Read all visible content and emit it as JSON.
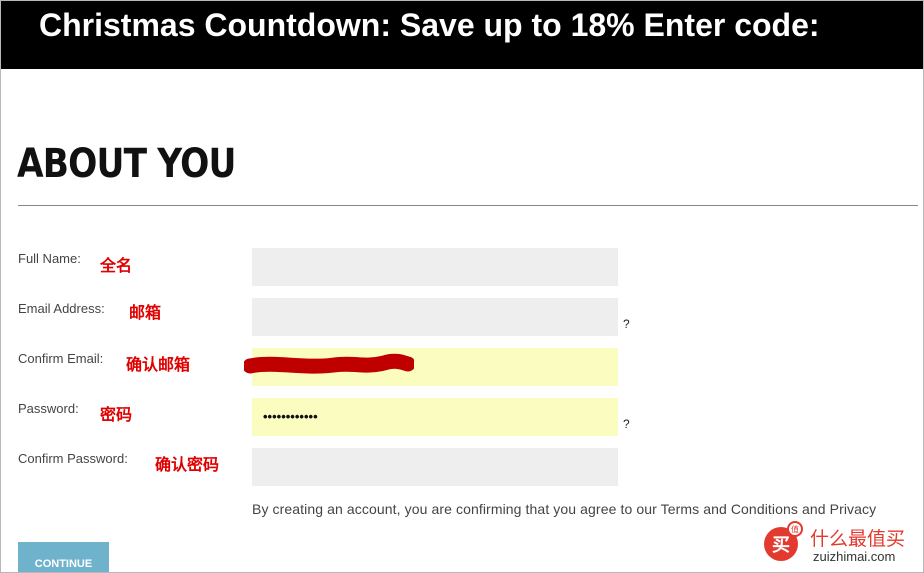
{
  "banner": {
    "text": "Christmas Countdown: Save up to 18% Enter code:"
  },
  "page_title": "ABOUT YOU",
  "form": {
    "full_name": {
      "label": "Full Name:",
      "annotation": "全名",
      "value": ""
    },
    "email": {
      "label": "Email Address:",
      "annotation": "邮箱",
      "value": "",
      "help": "?"
    },
    "confirm_email": {
      "label": "Confirm Email:",
      "annotation": "确认邮箱",
      "value": ""
    },
    "password": {
      "label": "Password:",
      "annotation": "密码",
      "value": "••••••••••••",
      "help": "?"
    },
    "confirm_password": {
      "label": "Confirm Password:",
      "annotation": "确认密码",
      "value": ""
    }
  },
  "terms_text": "By creating an account, you are confirming that you agree to our Terms and Conditions and Privacy",
  "continue_label": "CONTINUE",
  "watermark": {
    "logo_text": "买",
    "badge": "值",
    "name": "什么最值买",
    "url": "zuizhimai.com"
  },
  "colors": {
    "banner_bg": "#000000",
    "filled_field": "#fafcc0",
    "empty_field": "#eeeeee",
    "annotation": "#e00000",
    "button": "#6fb2cc"
  }
}
